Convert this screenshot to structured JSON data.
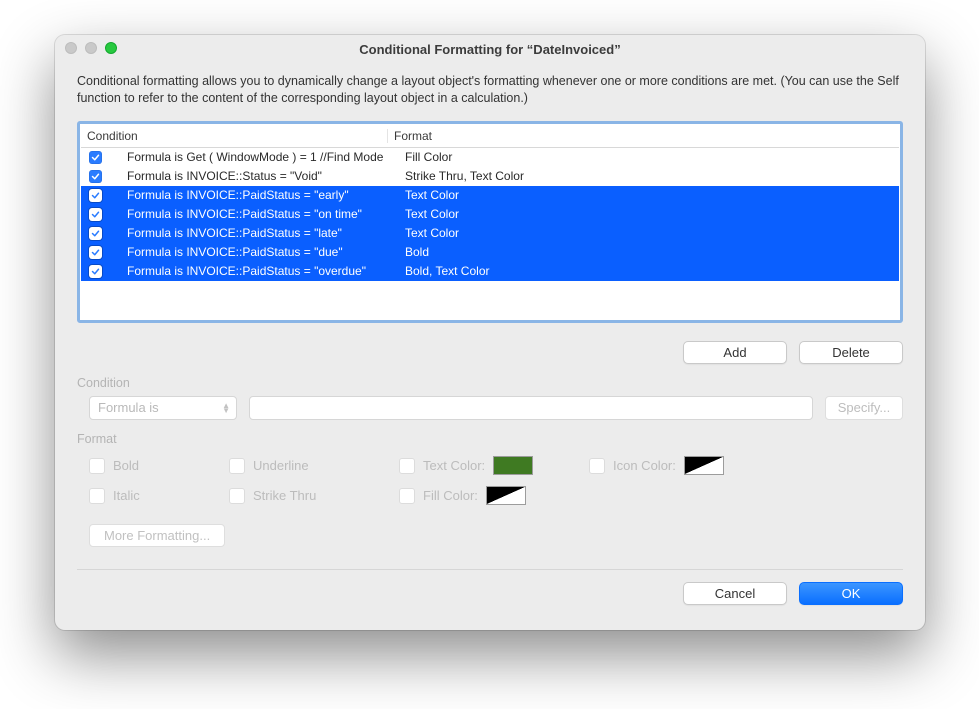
{
  "window": {
    "title": "Conditional Formatting for “DateInvoiced”"
  },
  "intro": "Conditional formatting allows you to dynamically change a layout object's formatting whenever one or more conditions are met.  (You can use the Self function to refer to the content of the corresponding layout object in a calculation.)",
  "list": {
    "headers": {
      "condition": "Condition",
      "format": "Format"
    },
    "rows": [
      {
        "checked": true,
        "selected": false,
        "condition": "Formula is Get ( WindowMode ) = 1 //Find Mode",
        "format": "Fill Color"
      },
      {
        "checked": true,
        "selected": false,
        "condition": "Formula is INVOICE::Status = \"Void\"",
        "format": "Strike Thru, Text Color"
      },
      {
        "checked": true,
        "selected": true,
        "condition": "Formula is INVOICE::PaidStatus = \"early\"",
        "format": "Text Color"
      },
      {
        "checked": true,
        "selected": true,
        "condition": "Formula is INVOICE::PaidStatus = \"on time\"",
        "format": "Text Color"
      },
      {
        "checked": true,
        "selected": true,
        "condition": "Formula is INVOICE::PaidStatus = \"late\"",
        "format": "Text Color"
      },
      {
        "checked": true,
        "selected": true,
        "condition": "Formula is INVOICE::PaidStatus = \"due\"",
        "format": "Bold"
      },
      {
        "checked": true,
        "selected": true,
        "condition": "Formula is INVOICE::PaidStatus = \"overdue\"",
        "format": "Bold, Text Color"
      }
    ]
  },
  "buttons": {
    "add": "Add",
    "delete": "Delete",
    "specify": "Specify...",
    "more": "More Formatting...",
    "cancel": "Cancel",
    "ok": "OK"
  },
  "labels": {
    "condition": "Condition",
    "format": "Format",
    "formula_is": "Formula is",
    "bold": "Bold",
    "italic": "Italic",
    "underline": "Underline",
    "strike": "Strike Thru",
    "text_color": "Text Color:",
    "fill_color": "Fill Color:",
    "icon_color": "Icon Color:"
  },
  "colors": {
    "text_swatch": "#3f7a22"
  }
}
